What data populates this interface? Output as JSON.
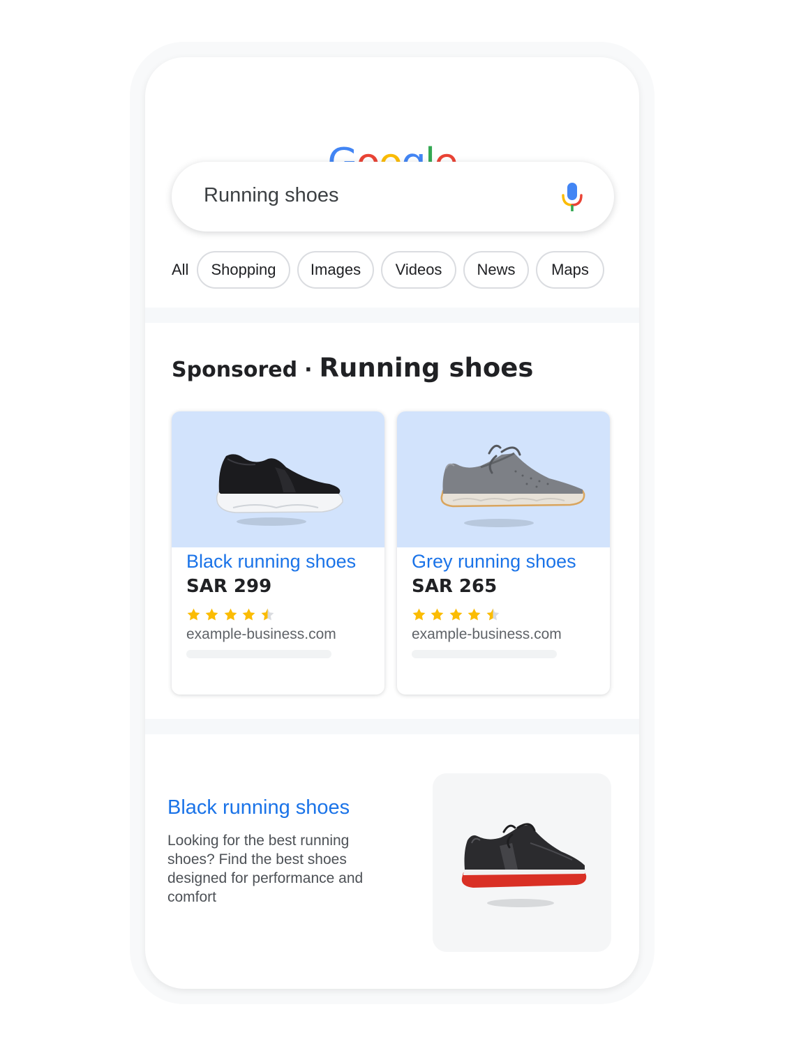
{
  "logo": {
    "letters": [
      {
        "char": "G",
        "color": "#4285F4"
      },
      {
        "char": "o",
        "color": "#EA4335"
      },
      {
        "char": "o",
        "color": "#FBBC05"
      },
      {
        "char": "g",
        "color": "#4285F4"
      },
      {
        "char": "l",
        "color": "#34A853"
      },
      {
        "char": "e",
        "color": "#EA4335"
      }
    ]
  },
  "search": {
    "query": "Running shoes",
    "mic_icon": "mic-icon"
  },
  "filters": {
    "all": "All",
    "chips": [
      "Shopping",
      "Images",
      "Videos",
      "News",
      "Maps"
    ]
  },
  "sponsored": {
    "label": "Sponsored",
    "separator": "·",
    "query": "Running shoes"
  },
  "products": [
    {
      "title": "Black running shoes",
      "price": "SAR 299",
      "rating": 4.5,
      "domain": "example-business.com",
      "image_icon": "black-slip-on-shoe-icon"
    },
    {
      "title": "Grey running shoes",
      "price": "SAR 265",
      "rating": 4.5,
      "domain": "example-business.com",
      "image_icon": "grey-lace-up-shoe-icon"
    }
  ],
  "result": {
    "title": "Black running shoes",
    "description": "Looking for the best running shoes? Find the best shoes designed for performance and comfort",
    "image_icon": "black-red-running-shoe-icon"
  },
  "colors": {
    "link_blue": "#1a73e8",
    "star_gold": "#FBBC04",
    "card_image_bg": "#d2e3fc"
  }
}
